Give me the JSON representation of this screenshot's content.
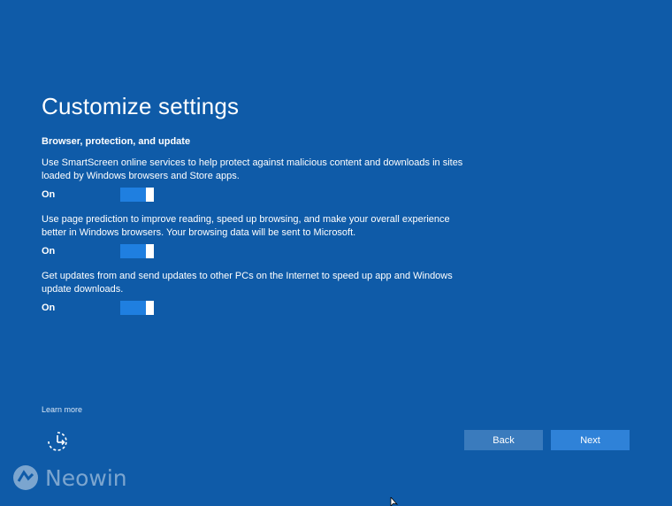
{
  "page": {
    "title": "Customize settings",
    "section_title": "Browser, protection, and update"
  },
  "settings": [
    {
      "description": "Use SmartScreen online services to help protect against malicious content and downloads in sites loaded by Windows browsers and Store apps.",
      "state_label": "On",
      "enabled": true
    },
    {
      "description": "Use page prediction to improve reading, speed up browsing, and make your overall experience better in Windows browsers. Your browsing data will be sent to Microsoft.",
      "state_label": "On",
      "enabled": true
    },
    {
      "description": "Get updates from and send updates to other PCs on the Internet to speed up app and Windows update downloads.",
      "state_label": "On",
      "enabled": true
    }
  ],
  "footer": {
    "learn_more": "Learn more",
    "back_label": "Back",
    "next_label": "Next",
    "accessibility_icon": "ease-of-access-icon"
  },
  "watermark": {
    "text": "Neowin"
  },
  "colors": {
    "background": "#0f5ba8",
    "toggle_on": "#1f7fe0",
    "back_button": "#3a7bbd",
    "next_button": "#2f82d8"
  }
}
